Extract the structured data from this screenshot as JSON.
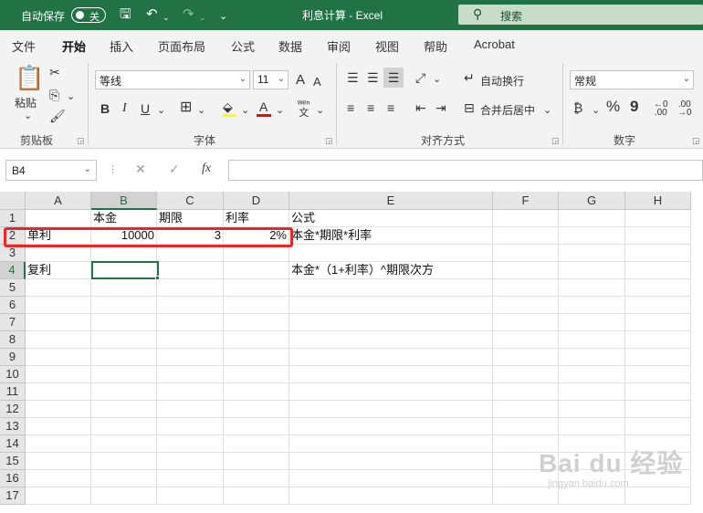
{
  "titlebar": {
    "autosave_label": "自动保存",
    "autosave_state": "关",
    "doc_title": "利息计算 - Excel",
    "search_label": "搜索"
  },
  "menu": {
    "tabs": [
      "文件",
      "开始",
      "插入",
      "页面布局",
      "公式",
      "数据",
      "审阅",
      "视图",
      "帮助",
      "Acrobat"
    ],
    "active": "开始"
  },
  "ribbon": {
    "clipboard": {
      "paste_label": "粘贴",
      "group_label": "剪贴板"
    },
    "font": {
      "font_name": "等线",
      "font_size": "11",
      "bold": "B",
      "italic": "I",
      "underline": "U",
      "grow": "A",
      "shrink": "A",
      "group_label": "字体",
      "font_color": "#ff0000",
      "highlight_color": "#ffff00"
    },
    "alignment": {
      "wrap_label": "自动换行",
      "merge_label": "合并后居中",
      "group_label": "对齐方式"
    },
    "number": {
      "format": "常规",
      "percent": "%",
      "comma": "9",
      "group_label": "数字"
    }
  },
  "formula_bar": {
    "name_box": "B4",
    "fx": "fx",
    "formula": ""
  },
  "sheet": {
    "columns": [
      "A",
      "B",
      "C",
      "D",
      "E",
      "F",
      "G",
      "H"
    ],
    "selected_column": "B",
    "rows": [
      "1",
      "2",
      "3",
      "4",
      "5",
      "6",
      "7",
      "8",
      "9",
      "10",
      "11",
      "12",
      "13",
      "14",
      "15",
      "16",
      "17"
    ],
    "selected_row": "4",
    "cells": {
      "B1": "本金",
      "C1": "期限",
      "D1": "利率",
      "E1": "公式",
      "A2": "单利",
      "B2": "10000",
      "C2": "3",
      "D2": "2%",
      "E2": "本金*期限*利率",
      "A4": "复利",
      "E4": "本金*（1+利率）^期限次方"
    }
  },
  "watermark": {
    "main": "Bai du 经验",
    "sub": "jingyan.baidu.com"
  },
  "colors": {
    "accent": "#217346",
    "highlight_box": "#e32a2a"
  }
}
